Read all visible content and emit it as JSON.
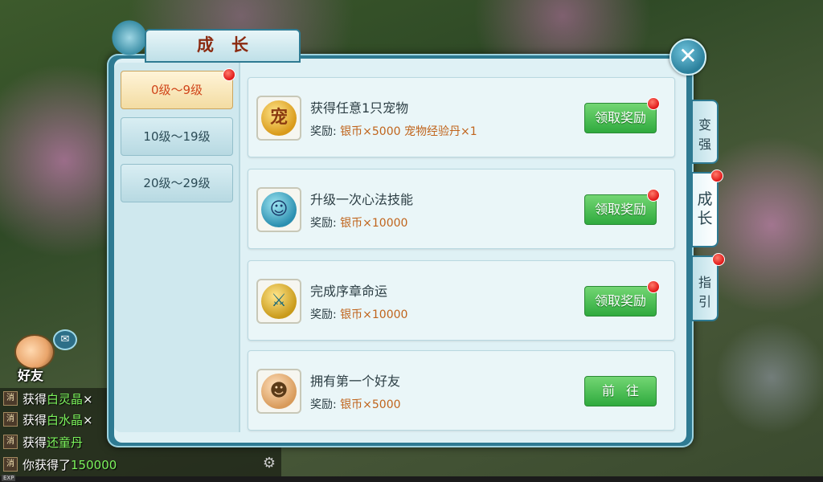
{
  "window": {
    "title": "成长",
    "close_label": "✕"
  },
  "levels": [
    {
      "label": "0级～9级",
      "active": true,
      "has_dot": true
    },
    {
      "label": "10级～19级",
      "active": false,
      "has_dot": false
    },
    {
      "label": "20级～29级",
      "active": false,
      "has_dot": false
    }
  ],
  "tasks": [
    {
      "icon": "pet-icon",
      "icon_glyph": "宠",
      "title": "获得任意1只宠物",
      "reward_label": "奖励:",
      "reward_value": "银币×5000  宠物经验丹×1",
      "button": "领取奖励",
      "has_dot": true
    },
    {
      "icon": "skill-icon",
      "icon_glyph": "☺",
      "title": "升级一次心法技能",
      "reward_label": "奖励:",
      "reward_value": "银币×10000",
      "button": "领取奖励",
      "has_dot": true
    },
    {
      "icon": "sword-emblem-icon",
      "icon_glyph": "⚔",
      "title": "完成序章命运",
      "reward_label": "奖励:",
      "reward_value": "银币×10000",
      "button": "领取奖励",
      "has_dot": true
    },
    {
      "icon": "friends-icon",
      "icon_glyph": "☻",
      "title": "拥有第一个好友",
      "reward_label": "奖励:",
      "reward_value": "银币×5000",
      "button": "前往",
      "has_dot": false
    }
  ],
  "side_tabs": [
    {
      "label_1": "变",
      "label_2": "强",
      "active": false
    },
    {
      "label_1": "成",
      "label_2": "长",
      "active": true
    },
    {
      "label_1": "指",
      "label_2": "引",
      "active": false
    }
  ],
  "friend": {
    "label": "好友"
  },
  "chat": [
    {
      "tag": "消",
      "prefix": "获得",
      "highlight": "白灵晶",
      "suffix": "×"
    },
    {
      "tag": "消",
      "prefix": "获得",
      "highlight": "白水晶",
      "suffix": "×"
    },
    {
      "tag": "消",
      "prefix": "获得",
      "highlight": "还童丹",
      "suffix": ""
    },
    {
      "tag": "消",
      "prefix": "你获得了",
      "highlight": "150000",
      "suffix": ""
    }
  ],
  "exp_label": "EXP",
  "colors": {
    "accent_frame": "#2e7a92",
    "button_green": "#2faa3e",
    "active_level_text": "#d0451a",
    "reward_orange": "#c0641c"
  }
}
